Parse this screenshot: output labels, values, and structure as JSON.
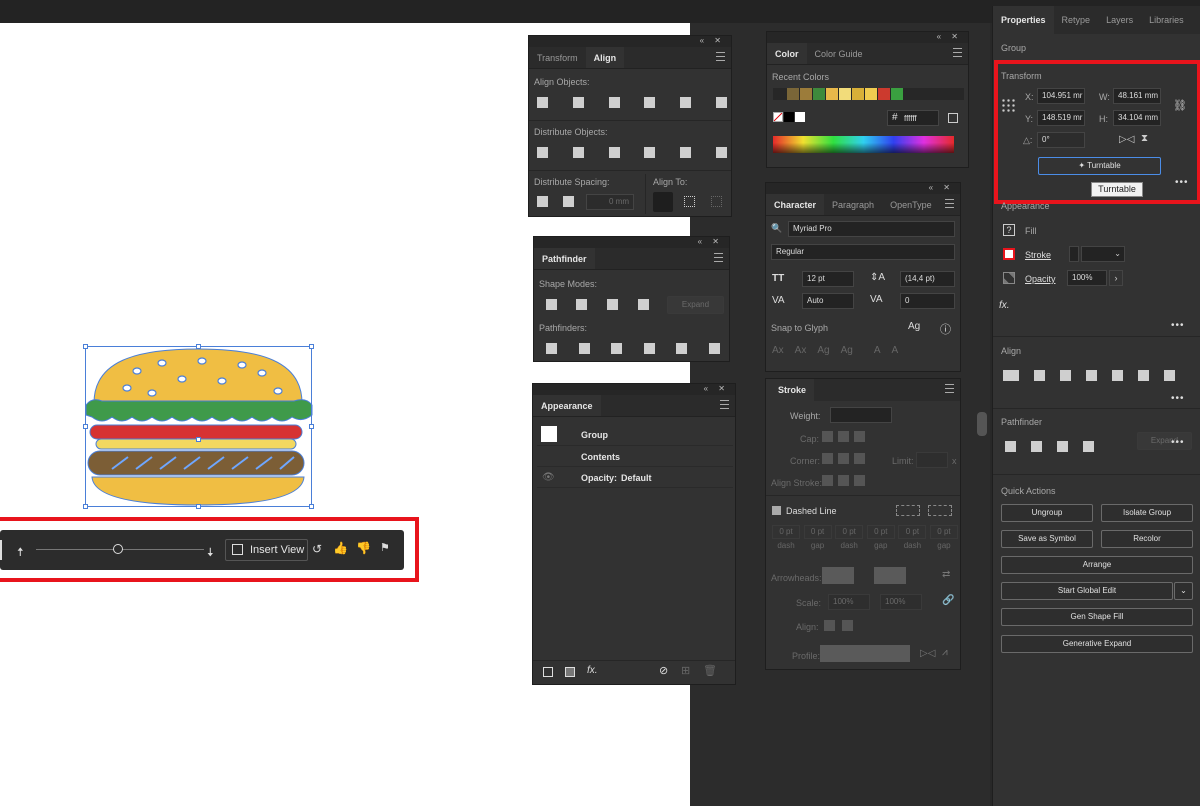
{
  "canvas": {
    "insert_view": "Insert View"
  },
  "align_panel": {
    "tabs": [
      "Transform",
      "Align"
    ],
    "align_objects": "Align Objects:",
    "distribute_objects": "Distribute Objects:",
    "distribute_spacing": "Distribute Spacing:",
    "align_to": "Align To:",
    "spacing_value": "0 mm"
  },
  "pathfinder_panel": {
    "tab": "Pathfinder",
    "shape_modes": "Shape Modes:",
    "pathfinders": "Pathfinders:",
    "expand": "Expand"
  },
  "appearance_panel": {
    "tab": "Appearance",
    "rows": [
      {
        "name": "Group"
      },
      {
        "name": "Contents"
      },
      {
        "name": "Opacity:",
        "value": "Default"
      }
    ]
  },
  "color_panel": {
    "tabs": [
      "Color",
      "Color Guide"
    ],
    "recent_colors_label": "Recent Colors",
    "swatches": [
      "#7a6638",
      "#9c7c3a",
      "#3e8a3c",
      "#e8b84a",
      "#f2dc7a",
      "#d8b038",
      "#f0cc50",
      "#cc3a2e",
      "#3aa040"
    ],
    "hex_label": "#",
    "hex_value": "ffffff"
  },
  "character_panel": {
    "tabs": [
      "Character",
      "Paragraph",
      "OpenType"
    ],
    "font_family": "Myriad Pro",
    "font_style": "Regular",
    "font_size": "12 pt",
    "leading": "(14,4 pt)",
    "kerning": "Auto",
    "tracking": "0",
    "snap_to_glyph": "Snap to Glyph"
  },
  "stroke_panel": {
    "tab": "Stroke",
    "weight": "Weight:",
    "cap": "Cap:",
    "corner": "Corner:",
    "limit": "Limit:",
    "limit_unit": "x",
    "align_stroke": "Align Stroke:",
    "dashed_line": "Dashed Line",
    "dash_values": [
      "0 pt",
      "0 pt",
      "0 pt",
      "0 pt",
      "0 pt",
      "0 pt"
    ],
    "dash_labels": [
      "dash",
      "gap",
      "dash",
      "gap",
      "dash",
      "gap"
    ],
    "arrowheads": "Arrowheads:",
    "scale": "Scale:",
    "scale_1": "100%",
    "scale_2": "100%",
    "align": "Align:",
    "profile": "Profile:"
  },
  "properties": {
    "tabs": [
      "Properties",
      "Retype",
      "Layers",
      "Libraries"
    ],
    "selection": "Group",
    "transform_title": "Transform",
    "x_label": "X:",
    "x_value": "104.951 mr",
    "y_label": "Y:",
    "y_value": "148.519 mr",
    "w_label": "W:",
    "w_value": "48.161 mm",
    "h_label": "H:",
    "h_value": "34.104 mm",
    "angle_label": "△:",
    "angle_value": "0°",
    "turntable": "Turntable",
    "tooltip": "Turntable",
    "appearance_title": "Appearance",
    "fill": "Fill",
    "stroke": "Stroke",
    "opacity": "Opacity",
    "opacity_value": "100%",
    "fx": "fx.",
    "align_title": "Align",
    "pathfinder_title": "Pathfinder",
    "expand": "Expand",
    "quick_actions_title": "Quick Actions",
    "ungroup": "Ungroup",
    "isolate_group": "Isolate Group",
    "save_as_symbol": "Save as Symbol",
    "recolor": "Recolor",
    "arrange": "Arrange",
    "start_global_edit": "Start Global Edit",
    "gen_shape_fill": "Gen Shape Fill",
    "generative_expand": "Generative Expand"
  },
  "colors": {
    "highlight": "#e8141c",
    "selection": "#4a7fd8"
  }
}
